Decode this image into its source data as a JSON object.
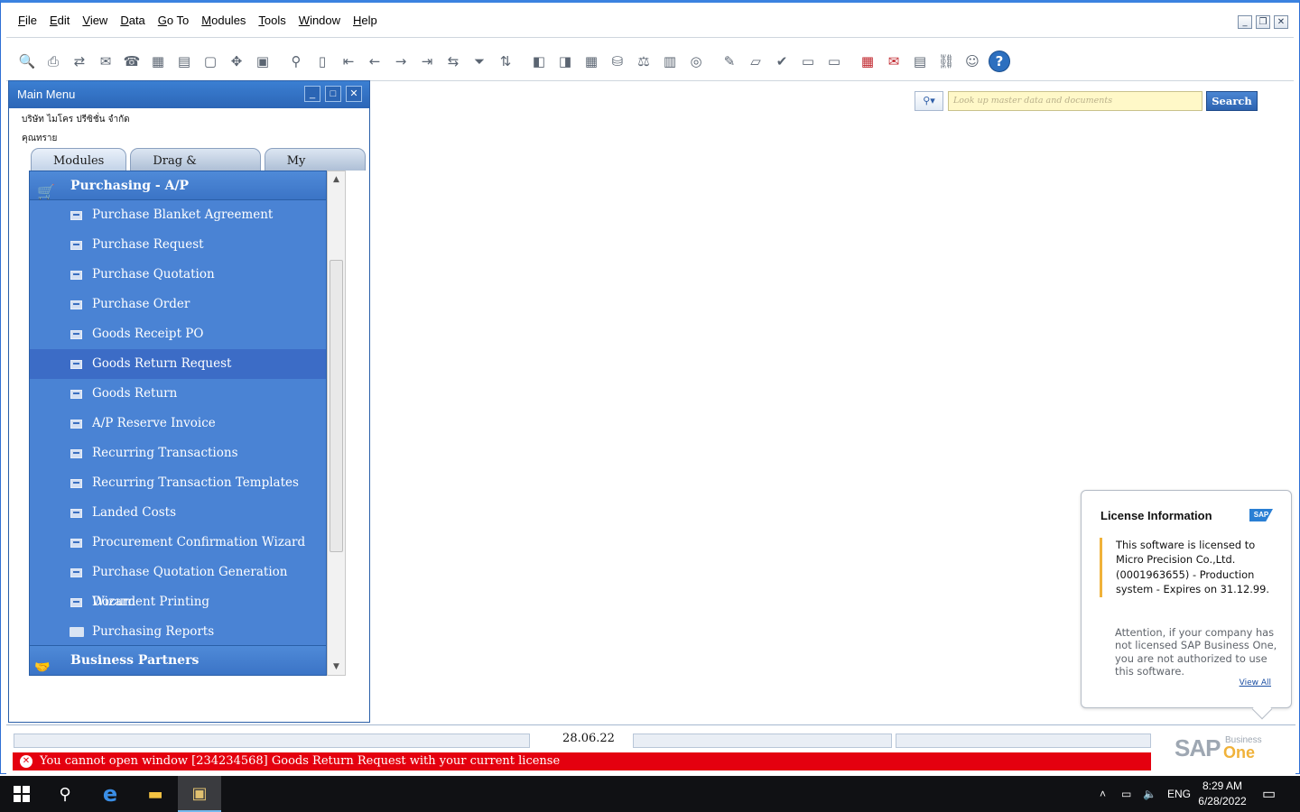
{
  "menubar": {
    "items": [
      "File",
      "Edit",
      "View",
      "Data",
      "Go To",
      "Modules",
      "Tools",
      "Window",
      "Help"
    ]
  },
  "toolbar": {
    "icons": [
      "preview-icon",
      "print-icon",
      "export-icon",
      "email-icon",
      "fax-icon",
      "excel-icon",
      "word-icon",
      "pdf-icon",
      "navigate-icon",
      "form-settings-icon",
      "find-icon",
      "add-icon",
      "first-record-icon",
      "previous-record-icon",
      "next-record-icon",
      "last-record-icon",
      "refresh-icon",
      "filter-icon",
      "sort-icon",
      "base-document-icon",
      "target-document-icon",
      "gross-profit-icon",
      "payment-means-icon",
      "volume-weight-icon",
      "journal-icon",
      "balance-icon",
      "edit-icon",
      "new-document-icon",
      "approve-icon",
      "message-icon",
      "reply-icon",
      "calendar-alert-icon",
      "mail-alert-icon",
      "notepad-icon",
      "organization-icon",
      "user-icon",
      "help-icon"
    ]
  },
  "main_menu": {
    "title": "Main Menu",
    "company": "บริษัท ไมโคร ปรีซิชั่น จำกัด",
    "user": "คุณทราย",
    "tabs": [
      "Modules",
      "Drag & Relate",
      "My Menu"
    ],
    "category": "Purchasing - A/P",
    "items": [
      {
        "label": "Purchase Blanket Agreement",
        "icon": "document-icon"
      },
      {
        "label": "Purchase Request",
        "icon": "document-icon"
      },
      {
        "label": "Purchase Quotation",
        "icon": "document-icon"
      },
      {
        "label": "Purchase Order",
        "icon": "document-icon"
      },
      {
        "label": "Goods Receipt PO",
        "icon": "document-icon"
      },
      {
        "label": "Goods Return Request",
        "icon": "document-icon"
      },
      {
        "label": "Goods Return",
        "icon": "document-icon"
      },
      {
        "label": "A/P Reserve Invoice",
        "icon": "document-icon"
      },
      {
        "label": "Recurring Transactions",
        "icon": "document-icon"
      },
      {
        "label": "Recurring Transaction Templates",
        "icon": "document-icon"
      },
      {
        "label": "Landed Costs",
        "icon": "document-icon"
      },
      {
        "label": "Procurement Confirmation Wizard",
        "icon": "document-icon"
      },
      {
        "label": "Purchase Quotation Generation Wizard",
        "icon": "document-icon"
      },
      {
        "label": "Document Printing",
        "icon": "document-icon"
      },
      {
        "label": "Purchasing Reports",
        "icon": "folder-icon"
      }
    ],
    "selected_item": "Goods Return Request",
    "next_category": "Business Partners"
  },
  "search": {
    "placeholder": "Look up master data and documents",
    "button": "Search"
  },
  "license": {
    "title": "License Information",
    "badge": "SAP",
    "body": "This software is licensed to Micro Precision Co.,Ltd. (0001963655) - Production system - Expires on 31.12.99.",
    "warning": "Attention, if your company has not licensed SAP Business One, you are not authorized to use this software.",
    "view_all": "View All"
  },
  "status": {
    "date": "28.06.22",
    "error": "You cannot open window [234234568] Goods Return Request with your current license"
  },
  "brand": {
    "sap": "SAP",
    "business": "Business",
    "one": "One",
    "accent": "#f0b23a"
  },
  "taskbar": {
    "language": "ENG",
    "time": "8:29 AM",
    "date": "6/28/2022"
  },
  "colors": {
    "menu_blue": "#4a83d4",
    "selected_blue": "#3c6cc6",
    "error_red": "#e4000f"
  }
}
